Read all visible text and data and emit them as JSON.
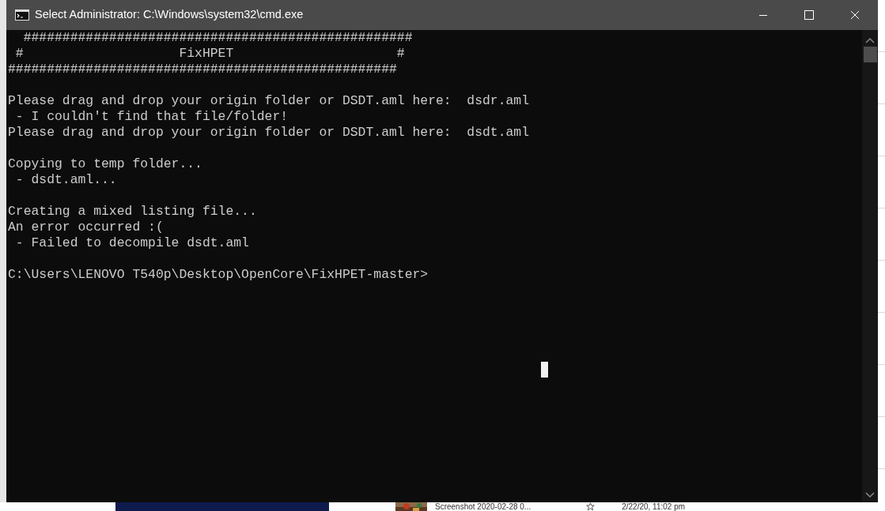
{
  "window": {
    "title": "Select Administrator: C:\\Windows\\system32\\cmd.exe"
  },
  "console": {
    "blocks": [
      [
        "  ##################################################",
        " #                    FixHPET                     #",
        "##################################################"
      ],
      [
        "Please drag and drop your origin folder or DSDT.aml here:  dsdr.aml",
        " - I couldn't find that file/folder!",
        "Please drag and drop your origin folder or DSDT.aml here:  dsdt.aml"
      ],
      [
        "Copying to temp folder...",
        " - dsdt.aml..."
      ],
      [
        "Creating a mixed listing file...",
        "An error occurred :(",
        " - Failed to decompile dsdt.aml"
      ],
      [
        "C:\\Users\\LENOVO T540p\\Desktop\\OpenCore\\FixHPET-master>"
      ]
    ]
  },
  "background": {
    "file_name": "Screenshot 2020-02-28 0...",
    "date": "2/22/20, 11:02 pm"
  }
}
